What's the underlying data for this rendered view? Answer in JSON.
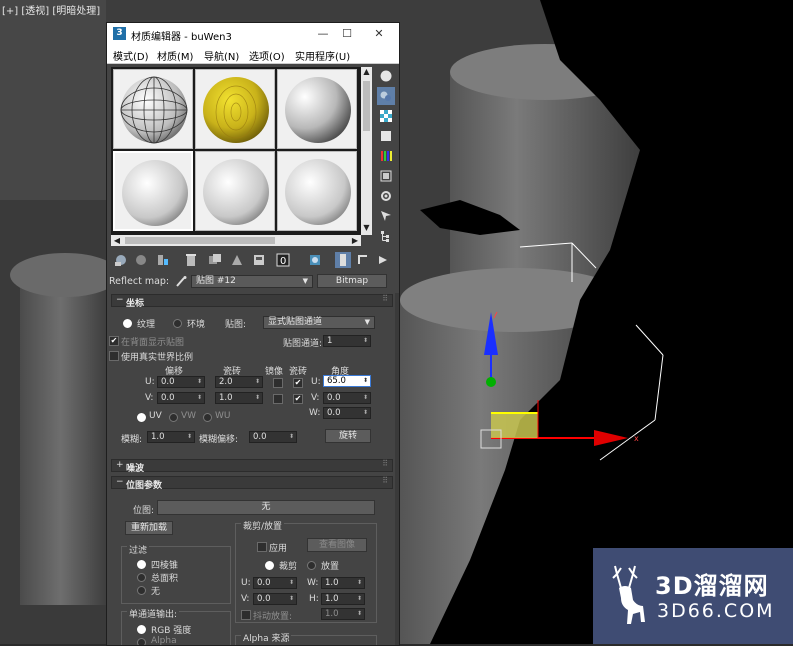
{
  "viewport": {
    "label": "[+] [透视] [明暗处理]",
    "axis_x": "x"
  },
  "window": {
    "title": "材质编辑器 - buWen3",
    "icon": "3",
    "minimize": "—",
    "maximize": "☐",
    "close": "✕"
  },
  "menu": [
    "模式(D)",
    "材质(M)",
    "导航(N)",
    "选项(O)",
    "实用程序(U)"
  ],
  "reflect": {
    "label": "Reflect map:",
    "map_name": "贴图 #12",
    "type_button": "Bitmap"
  },
  "coords": {
    "title": "坐标",
    "sign": "−",
    "radio_texture": "纹理",
    "radio_env": "环境",
    "mapping_label": "贴图:",
    "mapping_value": "显式贴图通道",
    "show_on_back": "在背面显示贴图",
    "channel_label": "贴图通道:",
    "channel_value": "1",
    "real_world": "使用真实世界比例",
    "col_offset": "偏移",
    "col_tiling": "瓷砖",
    "col_mirror": "镜像",
    "col_tile": "瓷砖",
    "col_angle": "角度",
    "u_label": "U:",
    "v_label": "V:",
    "w_label": "W:",
    "u_offset": "0.0",
    "v_offset": "0.0",
    "u_tiling": "2.0",
    "v_tiling": "1.0",
    "u_angle": "65.0",
    "v_angle": "0.0",
    "w_angle": "0.0",
    "uv": "UV",
    "vw": "VW",
    "wu": "WU",
    "blur_label": "模糊:",
    "blur_value": "1.0",
    "blur_offset_label": "模糊偏移:",
    "blur_offset_value": "0.0",
    "rotate_button": "旋转"
  },
  "noise": {
    "title": "噪波",
    "sign": "+"
  },
  "bitmap": {
    "title": "位图参数",
    "sign": "−",
    "bitmap_label": "位图:",
    "bitmap_value": "无",
    "reload": "重新加载",
    "crop_group": "裁剪/放置",
    "apply": "应用",
    "view_image": "查看图像",
    "crop": "裁剪",
    "place": "放置",
    "u_label": "U:",
    "u_value": "0.0",
    "w_label": "W:",
    "w_value": "1.0",
    "v_label": "V:",
    "v_value": "0.0",
    "h_label": "H:",
    "h_value": "1.0",
    "jitter_label": "抖动放置:",
    "jitter_value": "1.0",
    "filter_group": "过滤",
    "filter_pyramid": "四棱锥",
    "filter_sat": "总面积",
    "filter_none": "无",
    "mono_group": "单通道输出:",
    "mono_rgb": "RGB 强度",
    "mono_alpha": "Alpha",
    "alpha_group": "Alpha 来源"
  },
  "watermark": {
    "text_cn": "3D溜溜网",
    "text_url": "3D66.COM"
  }
}
